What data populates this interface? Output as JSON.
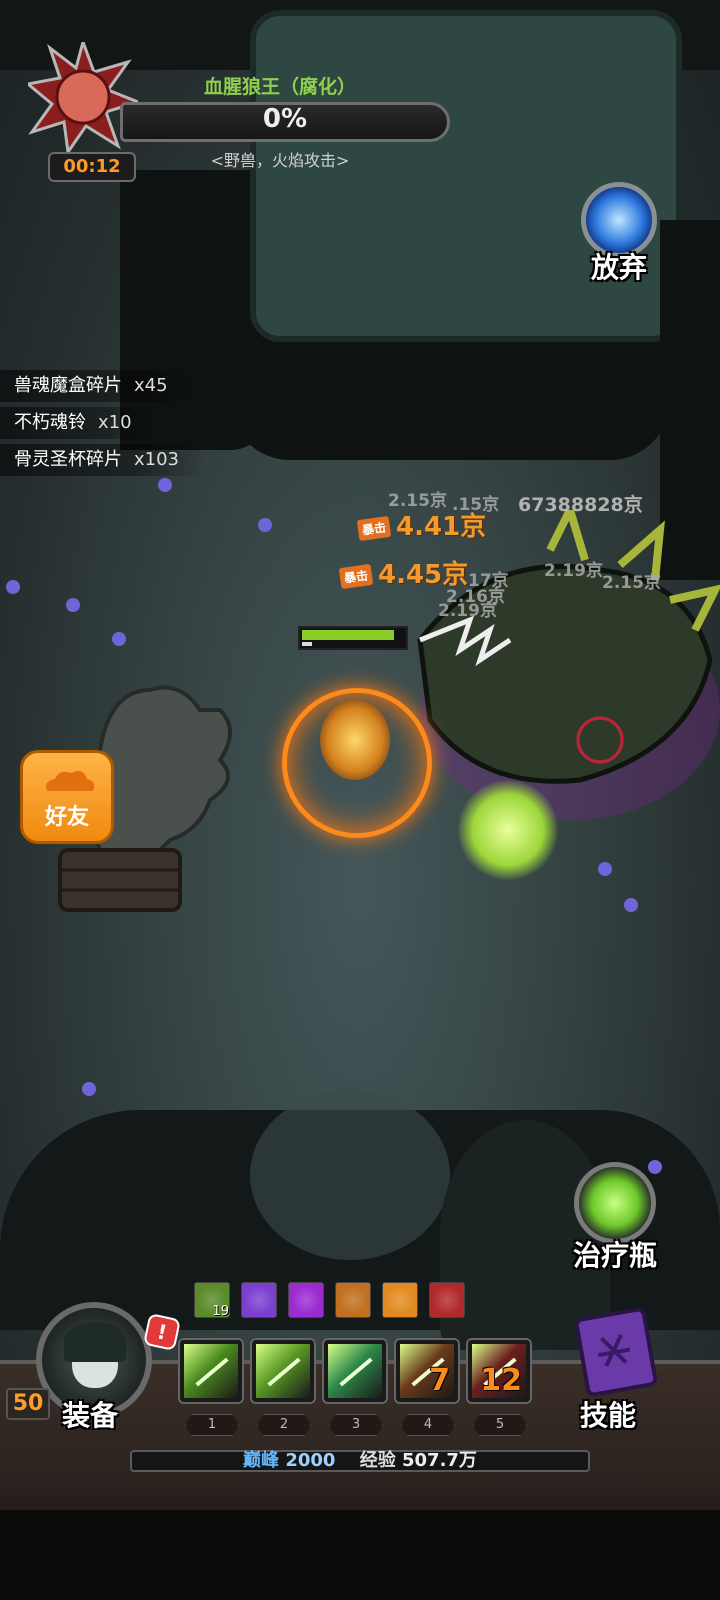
{
  "boss": {
    "name": "血腥狼王（腐化）",
    "hp_percent_text": "0%",
    "hp_percent": 0,
    "description": "<野兽，火焰攻击>",
    "timer": "00:12"
  },
  "loot": [
    {
      "name": "兽魂魔盒碎片",
      "count": "x45"
    },
    {
      "name": "不朽魂铃",
      "count": "x10"
    },
    {
      "name": "骨灵圣杯碎片",
      "count": "x103"
    }
  ],
  "buttons": {
    "give_up": "放弃",
    "friends": "好友",
    "potion": "治疗瓶",
    "equip": "装备",
    "skills": "技能"
  },
  "damage_numbers": {
    "crit_tag": "暴击",
    "crit_1": "4.41京",
    "crit_2": "4.45京",
    "big": "67388828京",
    "n1": "2.15京",
    "n2": ".15京",
    "n3": "2.19京",
    "n4": "2.15京",
    "n5": "17京",
    "n6": "2.16京",
    "n7": "2.19京"
  },
  "player": {
    "level": "50",
    "hp_fraction": 0.88,
    "alert": "!"
  },
  "buffs": [
    {
      "icon": "bone-icon",
      "count": "19",
      "color": "#5a8a2a"
    },
    {
      "icon": "heart-purple-icon",
      "count": "",
      "color": "#7b3fd0"
    },
    {
      "icon": "purple-slash-icon",
      "count": "",
      "color": "#9b2bd0"
    },
    {
      "icon": "orange-spark-icon",
      "count": "",
      "color": "#c07020"
    },
    {
      "icon": "flame-slash-icon",
      "count": "",
      "color": "#e08a20"
    },
    {
      "icon": "red-swirl-icon",
      "count": "",
      "color": "#b02a2a"
    }
  ],
  "skill_slots": [
    {
      "index": "1",
      "cooldown": "",
      "color": "#4a8a1e",
      "icon": "arrow-volley-icon"
    },
    {
      "index": "2",
      "cooldown": "",
      "color": "#5a9a24",
      "icon": "double-arrow-icon"
    },
    {
      "index": "3",
      "cooldown": "",
      "color": "#2e8a4a",
      "icon": "arrow-rain-icon"
    },
    {
      "index": "4",
      "cooldown": "7",
      "color": "#6a3a1a",
      "icon": "fire-arrow-icon"
    },
    {
      "index": "5",
      "cooldown": "12",
      "color": "#6a1e1e",
      "icon": "blood-arrow-icon"
    }
  ],
  "status_bar": {
    "peak_label": "巅峰",
    "peak_value": "2000",
    "xp_label": "经验",
    "xp_value": "507.7万"
  }
}
